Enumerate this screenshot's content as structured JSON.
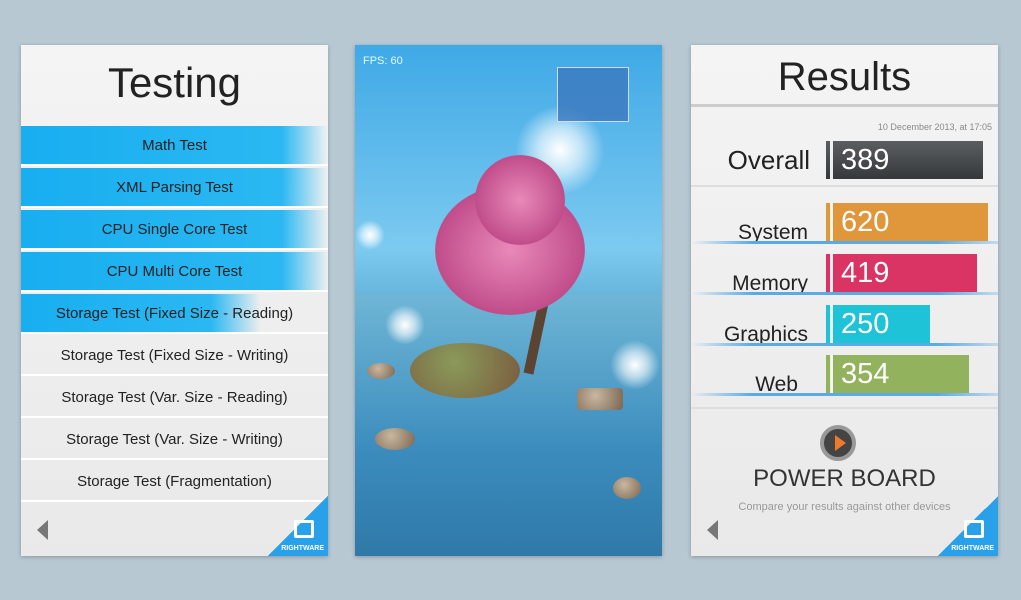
{
  "testing": {
    "title": "Testing",
    "items": [
      {
        "label": "Math Test",
        "state": "done"
      },
      {
        "label": "XML Parsing Test",
        "state": "done"
      },
      {
        "label": "CPU Single Core Test",
        "state": "done"
      },
      {
        "label": "CPU Multi Core Test",
        "state": "done"
      },
      {
        "label": "Storage Test (Fixed Size - Reading)",
        "state": "in-progress"
      },
      {
        "label": "Storage Test (Fixed Size - Writing)",
        "state": "pending"
      },
      {
        "label": "Storage Test (Var. Size - Reading)",
        "state": "pending"
      },
      {
        "label": "Storage Test (Var. Size - Writing)",
        "state": "pending"
      },
      {
        "label": "Storage Test (Fragmentation)",
        "state": "pending"
      }
    ],
    "brand": "RIGHTWARE"
  },
  "scene": {
    "fps": "FPS: 60"
  },
  "results": {
    "title": "Results",
    "date": "10 December 2013, at 17:05",
    "overall": {
      "label": "Overall",
      "value": "389",
      "color": "#4a4d50"
    },
    "scores": [
      {
        "label": "System",
        "value": "620",
        "color": "#e0963a"
      },
      {
        "label": "Memory",
        "value": "419",
        "color": "#d93463"
      },
      {
        "label": "Graphics",
        "value": "250",
        "color": "#1ec3d8"
      },
      {
        "label": "Web",
        "value": "354",
        "color": "#93b25e"
      }
    ],
    "powerboard": "POWER BOARD",
    "compare": "Compare your results against other devices",
    "brand": "RIGHTWARE"
  }
}
